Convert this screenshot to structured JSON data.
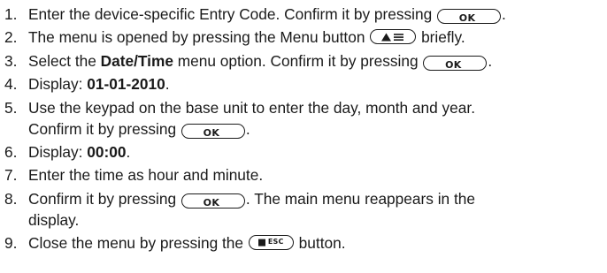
{
  "steps": [
    {
      "number": "1.",
      "before": "Enter the device-specific Entry Code. Confirm it by pressing",
      "key": "OK",
      "after": "."
    },
    {
      "number": "2.",
      "before": "The menu is opened by pressing the Menu button",
      "key_icon": "menu-up-arrow-lines-icon",
      "after": "briefly."
    },
    {
      "number": "3.",
      "before": "Select the",
      "bold": "Date/Time",
      "middle": "menu option. Confirm it by pressing",
      "key": "OK",
      "after": "."
    },
    {
      "number": "4.",
      "before": "Display:",
      "bold": "01-01-2010",
      "after": "."
    },
    {
      "number": "5.",
      "line1": "Use the keypad on the base unit to enter the day, month and year.",
      "line2_before": "Confirm it by pressing",
      "key": "OK",
      "after": "."
    },
    {
      "number": "6.",
      "before": "Display:",
      "bold": "00:00",
      "after": "."
    },
    {
      "number": "7.",
      "text": "Enter the time as hour and minute."
    },
    {
      "number": "8.",
      "before": "Confirm it by pressing",
      "key": "OK",
      "after_line1": ". The main menu reappears in the",
      "line2": "display."
    },
    {
      "number": "9.",
      "before": "Close the menu by pressing the",
      "key": "ESC",
      "key_icon": "stop-square-icon",
      "after": "button."
    }
  ]
}
